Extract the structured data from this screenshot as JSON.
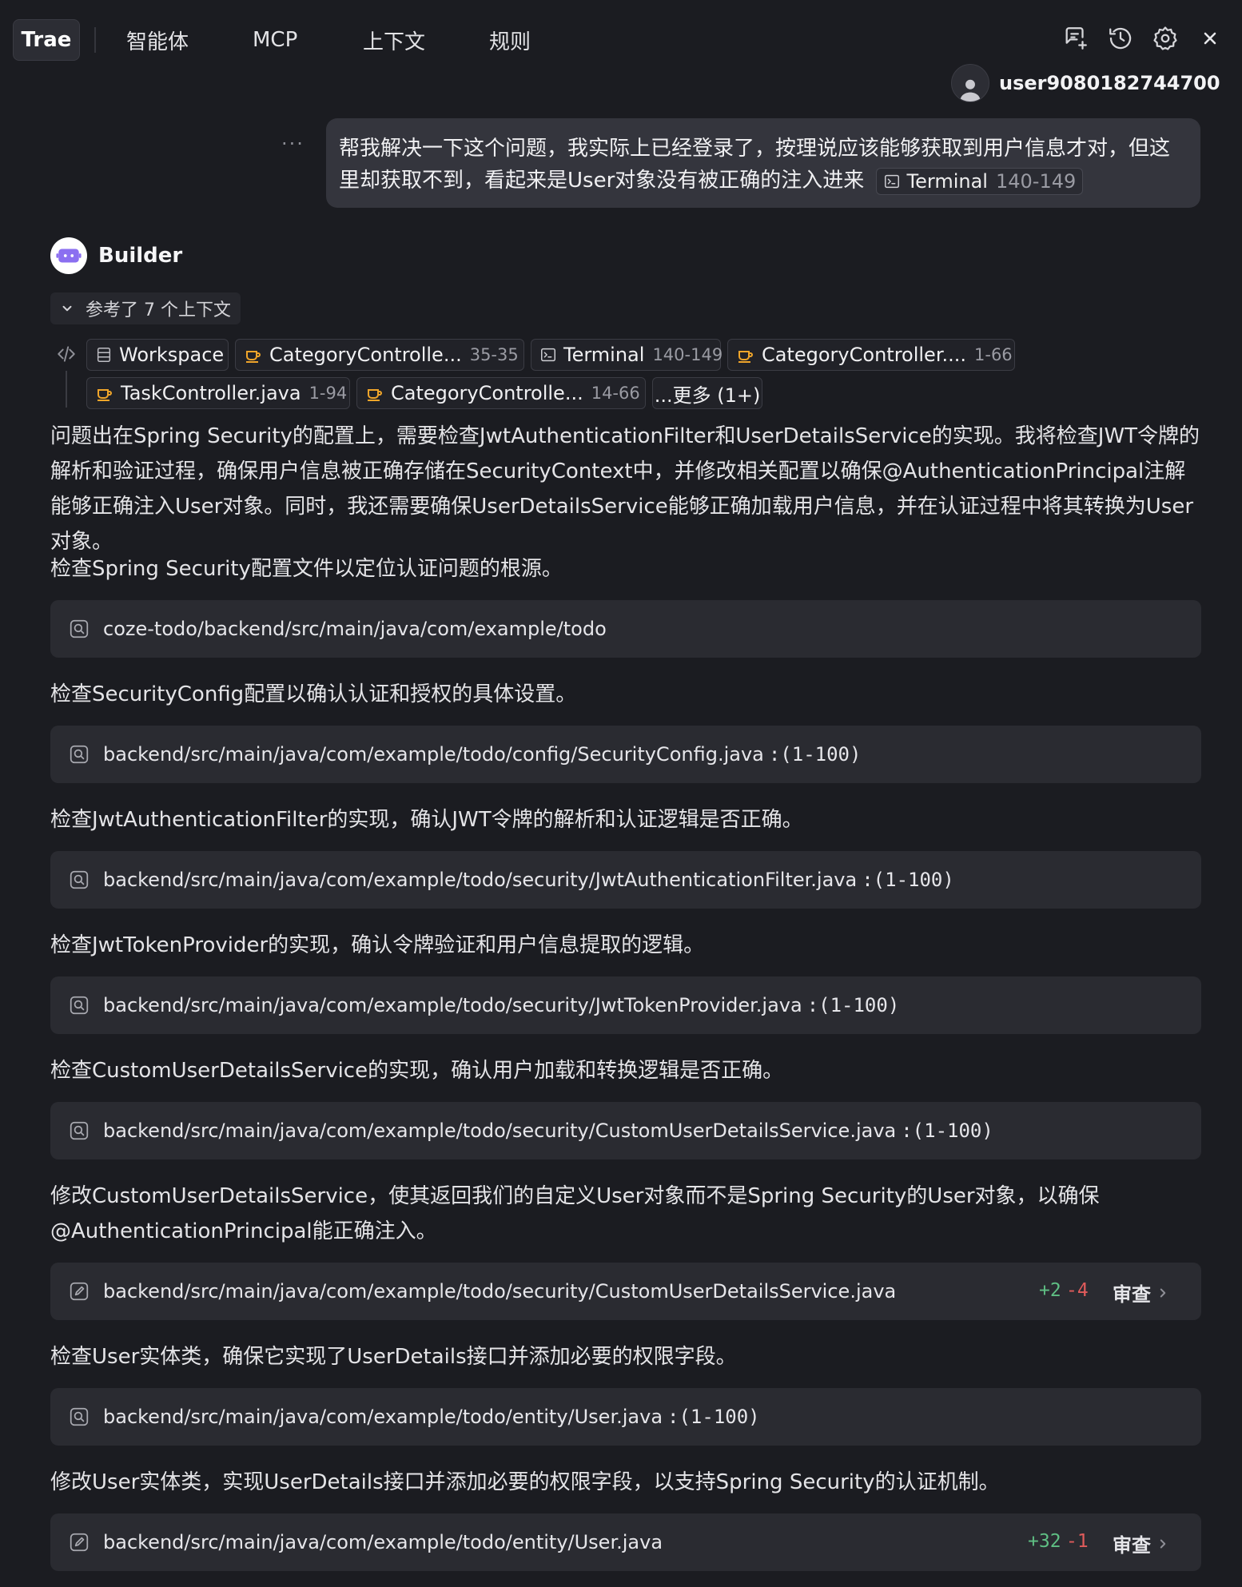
{
  "header": {
    "tabs": [
      "Trae",
      "智能体",
      "MCP",
      "上下文",
      "规则"
    ],
    "icons": [
      "new-chat-icon",
      "history-icon",
      "settings-icon",
      "close-icon"
    ]
  },
  "user": {
    "name": "user9080182744700",
    "message": "帮我解决一下这个问题，我实际上已经登录了，按理说应该能够获取到用户信息才对，但这里却获取不到，看起来是User对象没有被正确的注入进来",
    "chip_label": "Terminal",
    "chip_range": "140-149"
  },
  "assistant": {
    "name": "Builder",
    "context_toggle": "参考了 7 个上下文",
    "context_chips": [
      {
        "label": "Workspace",
        "range": ""
      },
      {
        "label": "CategoryControlle...",
        "range": "35-35"
      },
      {
        "label": "Terminal",
        "range": "140-149"
      },
      {
        "label": "CategoryController....",
        "range": "1-66"
      },
      {
        "label": "TaskController.java",
        "range": "1-94"
      },
      {
        "label": "CategoryControlle...",
        "range": "14-66"
      },
      {
        "label": "...更多 (1+)",
        "range": ""
      }
    ]
  },
  "steps": [
    {
      "type": "text",
      "text": "问题出在Spring Security的配置上，需要检查JwtAuthenticationFilter和UserDetailsService的实现。我将检查JWT令牌的解析和验证过程，确保用户信息被正确存储在SecurityContext中，并修改相关配置以确保@AuthenticationPrincipal注解能够正确注入User对象。同时，我还需要确保UserDetailsService能够正确加载用户信息，并在认证过程中将其转换为User对象。"
    },
    {
      "type": "text",
      "text": "检查Spring Security配置文件以定位认证问题的根源。"
    },
    {
      "type": "search",
      "path": "coze-todo/backend/src/main/java/com/example/todo",
      "range": ""
    },
    {
      "type": "text",
      "text": "检查SecurityConfig配置以确认认证和授权的具体设置。"
    },
    {
      "type": "search",
      "path": "backend/src/main/java/com/example/todo/config/SecurityConfig.java",
      "range": ":(1-100)"
    },
    {
      "type": "text",
      "text": "检查JwtAuthenticationFilter的实现，确认JWT令牌的解析和认证逻辑是否正确。"
    },
    {
      "type": "search",
      "path": "backend/src/main/java/com/example/todo/security/JwtAuthenticationFilter.java",
      "range": ":(1-100)"
    },
    {
      "type": "text",
      "text": "检查JwtTokenProvider的实现，确认令牌验证和用户信息提取的逻辑。"
    },
    {
      "type": "search",
      "path": "backend/src/main/java/com/example/todo/security/JwtTokenProvider.java",
      "range": ":(1-100)"
    },
    {
      "type": "text",
      "text": "检查CustomUserDetailsService的实现，确认用户加载和转换逻辑是否正确。"
    },
    {
      "type": "search",
      "path": "backend/src/main/java/com/example/todo/security/CustomUserDetailsService.java",
      "range": ":(1-100)"
    },
    {
      "type": "text",
      "text": "修改CustomUserDetailsService，使其返回我们的自定义User对象而不是Spring Security的User对象，以确保@AuthenticationPrincipal能正确注入。"
    },
    {
      "type": "edit",
      "path": "backend/src/main/java/com/example/todo/security/CustomUserDetailsService.java",
      "added": "+2",
      "removed": "-4",
      "action": "审查"
    },
    {
      "type": "text",
      "text": "检查User实体类，确保它实现了UserDetails接口并添加必要的权限字段。"
    },
    {
      "type": "search",
      "path": "backend/src/main/java/com/example/todo/entity/User.java",
      "range": ":(1-100)"
    },
    {
      "type": "text",
      "text": "修改User实体类，实现UserDetails接口并添加必要的权限字段，以支持Spring Security的认证机制。"
    },
    {
      "type": "edit",
      "path": "backend/src/main/java/com/example/todo/entity/User.java",
      "added": "+32",
      "removed": "-1",
      "action": "审查"
    }
  ],
  "colors": {
    "background": "#1b1c21",
    "card": "#2a2b31",
    "bubble": "#34353d",
    "added": "#5fbf84",
    "removed": "#e05b5b",
    "builder_accent": "#8b6ff0",
    "java_icon": "#f0a52a"
  }
}
